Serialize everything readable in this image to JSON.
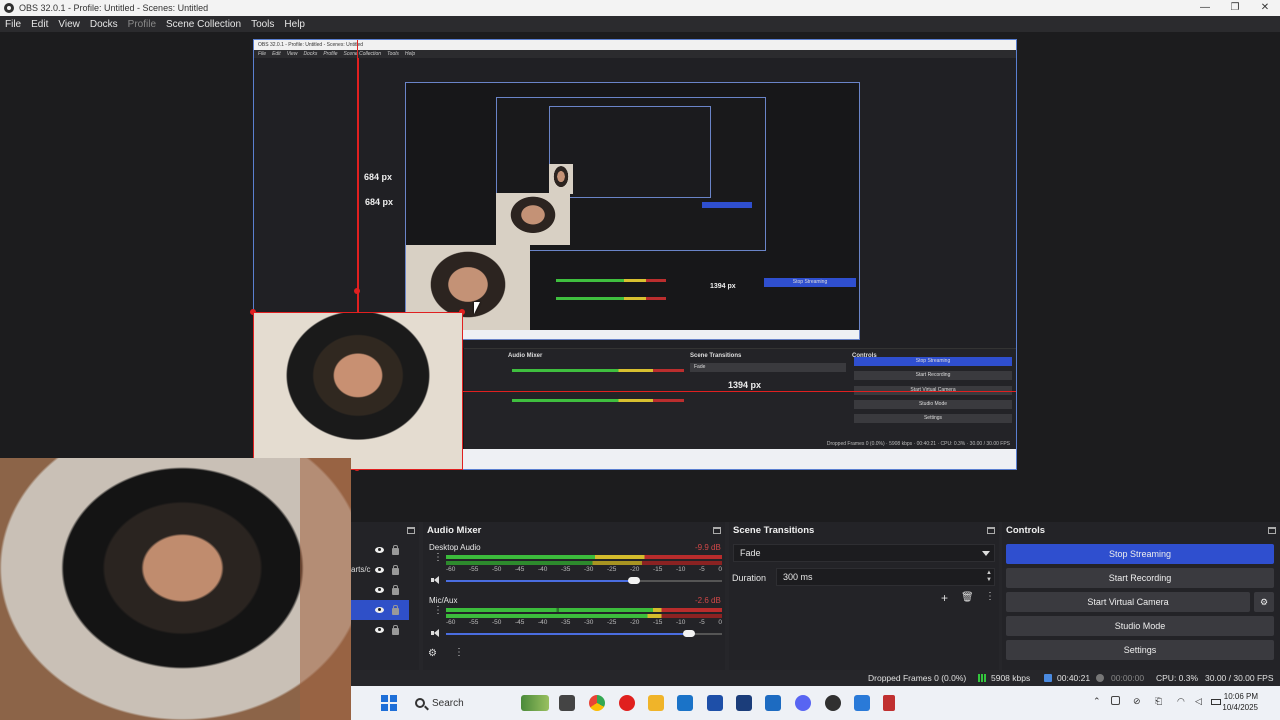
{
  "window": {
    "title": "OBS 32.0.1 - Profile: Untitled - Scenes: Untitled",
    "controls": [
      "—",
      "❐",
      "✕"
    ]
  },
  "menu": {
    "items": [
      "File",
      "Edit",
      "View",
      "Docks",
      "Profile",
      "Scene Collection",
      "Tools",
      "Help"
    ]
  },
  "preview": {
    "height_label": "684 px",
    "nested_height_label": "684 px",
    "nested_duration_label": "1394 px",
    "duration_overlay": "1394 px"
  },
  "sources": {
    "partial_label": "arts/c",
    "rows": [
      {
        "visible": true,
        "locked": true,
        "selected": false
      },
      {
        "visible": true,
        "locked": true,
        "selected": false
      },
      {
        "visible": true,
        "locked": true,
        "selected": false
      },
      {
        "visible": true,
        "locked": true,
        "selected": true
      },
      {
        "visible": true,
        "locked": true,
        "selected": false
      }
    ]
  },
  "audio_mixer": {
    "title": "Audio Mixer",
    "channels": [
      {
        "name": "Desktop Audio",
        "db": "-9.9 dB",
        "volume_fraction": 0.68
      },
      {
        "name": "Mic/Aux",
        "db": "-2.6 dB",
        "volume_fraction": 0.88
      }
    ],
    "scale": [
      "-60",
      "-55",
      "-50",
      "-45",
      "-40",
      "-35",
      "-30",
      "-25",
      "-20",
      "-15",
      "-10",
      "-5",
      "0"
    ]
  },
  "scene_transitions": {
    "title": "Scene Transitions",
    "transition": "Fade",
    "duration_label": "Duration",
    "duration_value": "300 ms"
  },
  "controls": {
    "title": "Controls",
    "buttons": [
      "Stop Streaming",
      "Start Recording",
      "Start Virtual Camera",
      "Studio Mode",
      "Settings"
    ]
  },
  "status": {
    "dropped_frames": "Dropped Frames 0 (0.0%)",
    "bitrate": "5908 kbps",
    "stream_time": "00:40:21",
    "rec_time": "00:00:00",
    "cpu": "CPU: 0.3%",
    "fps": "30.00 / 30.00 FPS"
  },
  "taskbar": {
    "search_placeholder": "Search",
    "time": "10:06 PM",
    "date": "10/4/2025"
  },
  "colors": {
    "accent": "#2f4fcf",
    "selection_red": "#e02020",
    "meter_green": "#3cbc3c",
    "meter_yellow": "#d4bc2c",
    "meter_red": "#b82c2c"
  }
}
